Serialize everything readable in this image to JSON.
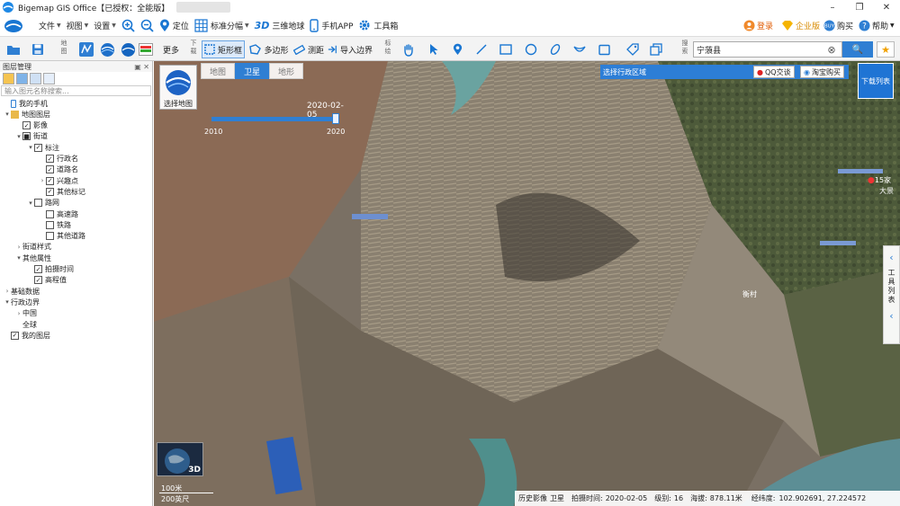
{
  "window": {
    "title": "Bigemap GIS Office【已授权：全能版】",
    "minimize": "–",
    "maximize": "❐",
    "close": "✕"
  },
  "menu": {
    "items": [
      {
        "label": "文件",
        "icon": "file-icon"
      },
      {
        "label": "视图",
        "icon": "view-icon"
      },
      {
        "label": "设置",
        "icon": "settings-icon"
      }
    ],
    "tools": [
      {
        "label": "定位",
        "icon": "location-pin-icon"
      },
      {
        "label": "标准分幅",
        "icon": "grid-icon"
      },
      {
        "label": "三维地球",
        "icon": "3d-icon",
        "icon_text": "3D"
      },
      {
        "label": "手机APP",
        "icon": "phone-icon"
      },
      {
        "label": "工具箱",
        "icon": "gear-icon"
      }
    ],
    "right": {
      "login": "登录",
      "enterprise": "企业版",
      "buy": "购买",
      "help": "帮助"
    }
  },
  "toolbar": {
    "more": "更多",
    "section_map": "地图",
    "section_download": "下载",
    "section_mark": "标绘",
    "section_search": "搜索",
    "rect_select": "矩形框",
    "polygon": "多边形",
    "measure": "测距",
    "import_border": "导入边界",
    "search_value": "宁蒗县",
    "clear": "⊗",
    "search_btn": "🔍",
    "star": "★"
  },
  "layer_panel": {
    "title": "图层管理",
    "search_placeholder": "输入图元名称搜索...",
    "nodes": [
      {
        "label": "我的手机",
        "depth": 0,
        "arrow": "",
        "check": "",
        "icon": "phone"
      },
      {
        "label": "地图图层",
        "depth": 0,
        "arrow": "▾",
        "check": "",
        "icon": "layers"
      },
      {
        "label": "影像",
        "depth": 1,
        "arrow": "",
        "check": "✓",
        "icon": ""
      },
      {
        "label": "街道",
        "depth": 1,
        "arrow": "▾",
        "check": "■",
        "icon": ""
      },
      {
        "label": "标注",
        "depth": 2,
        "arrow": "▾",
        "check": "✓",
        "icon": ""
      },
      {
        "label": "行政名",
        "depth": 3,
        "arrow": "",
        "check": "✓",
        "icon": ""
      },
      {
        "label": "道路名",
        "depth": 3,
        "arrow": "",
        "check": "✓",
        "icon": ""
      },
      {
        "label": "兴趣点",
        "depth": 3,
        "arrow": "›",
        "check": "✓",
        "icon": ""
      },
      {
        "label": "其他标记",
        "depth": 3,
        "arrow": "",
        "check": "✓",
        "icon": ""
      },
      {
        "label": "路网",
        "depth": 2,
        "arrow": "▾",
        "check": "□",
        "icon": ""
      },
      {
        "label": "高速路",
        "depth": 3,
        "arrow": "",
        "check": "□",
        "icon": ""
      },
      {
        "label": "铁路",
        "depth": 3,
        "arrow": "",
        "check": "□",
        "icon": ""
      },
      {
        "label": "其他道路",
        "depth": 3,
        "arrow": "",
        "check": "□",
        "icon": ""
      },
      {
        "label": "街道样式",
        "depth": 1,
        "arrow": "›",
        "check": "",
        "icon": ""
      },
      {
        "label": "其他属性",
        "depth": 1,
        "arrow": "▾",
        "check": "",
        "icon": ""
      },
      {
        "label": "拍摄时间",
        "depth": 2,
        "arrow": "",
        "check": "✓",
        "icon": ""
      },
      {
        "label": "高程值",
        "depth": 2,
        "arrow": "",
        "check": "✓",
        "icon": ""
      },
      {
        "label": "基础数据",
        "depth": 0,
        "arrow": "›",
        "check": "",
        "icon": ""
      },
      {
        "label": "行政边界",
        "depth": 0,
        "arrow": "▾",
        "check": "",
        "icon": ""
      },
      {
        "label": "中国",
        "depth": 1,
        "arrow": "›",
        "check": "",
        "icon": ""
      },
      {
        "label": "全球",
        "depth": 1,
        "arrow": "",
        "check": "",
        "icon": ""
      },
      {
        "label": "我的图层",
        "depth": 0,
        "arrow": "",
        "check": "✓",
        "icon": ""
      }
    ]
  },
  "map": {
    "tabs": [
      {
        "label": "地图",
        "active": false
      },
      {
        "label": "卫星",
        "active": true
      },
      {
        "label": "地形",
        "active": false
      }
    ],
    "select_map": "选择地图",
    "timeline": {
      "current": "2020-02-05",
      "start": "2010",
      "end": "2020"
    },
    "region_select": "选择行政区域",
    "qq": "QQ交谈",
    "taobao": "淘宝购买",
    "download_list": "下载列表",
    "side_tool_label": "工具列表",
    "poi_label": "15家",
    "poi_label2": "大景",
    "village_label": "衡村",
    "minimap_3d": "3D",
    "scale": {
      "top": "100米",
      "bottom": "200英尺"
    },
    "status": {
      "history": "历史影像",
      "type": "卫星",
      "shot_label": "拍摄时间:",
      "shot_time": "2020-02-05",
      "level_label": "级别:",
      "level": "16",
      "alt_label": "海拔:",
      "alt": "878.11米",
      "coord_label": "经纬度:",
      "coord": "102.902691, 27.224572"
    }
  },
  "colors": {
    "accent": "#2f7fd3",
    "titlebar": "#ffffff",
    "toolbar": "#f3f3f3"
  }
}
